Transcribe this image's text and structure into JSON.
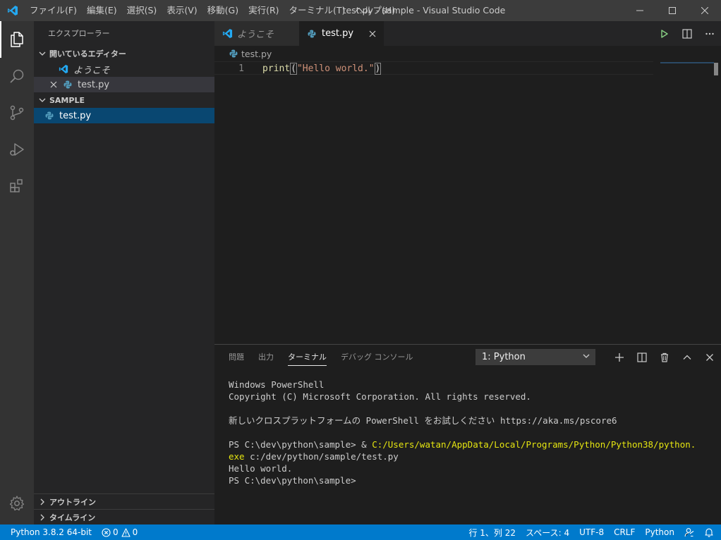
{
  "titlebar": {
    "menus": [
      "ファイル(F)",
      "編集(E)",
      "選択(S)",
      "表示(V)",
      "移動(G)",
      "実行(R)",
      "ターミナル(T)",
      "ヘルプ(H)"
    ],
    "title": "test.py - sample - Visual Studio Code"
  },
  "sidebar": {
    "title": "エクスプローラー",
    "open_editors": {
      "header": "開いているエディター",
      "items": [
        {
          "label": "ようこそ",
          "icon": "vscode-logo-icon"
        },
        {
          "label": "test.py",
          "icon": "python-icon"
        }
      ]
    },
    "folder": {
      "header": "SAMPLE",
      "items": [
        {
          "label": "test.py",
          "icon": "python-icon"
        }
      ]
    },
    "outline": "アウトライン",
    "timeline": "タイムライン"
  },
  "editor": {
    "tabs": [
      {
        "label": "ようこそ",
        "active": false
      },
      {
        "label": "test.py",
        "active": true
      }
    ],
    "breadcrumb": "test.py",
    "lines": [
      {
        "number": "1",
        "fn": "print",
        "open": "(",
        "str": "\"Hello world.\"",
        "close": ")"
      }
    ]
  },
  "panel": {
    "tabs": [
      "問題",
      "出力",
      "ターミナル",
      "デバッグ コンソール"
    ],
    "active_tab": "ターミナル",
    "terminal_select": "1: Python",
    "terminal": {
      "l1": "Windows PowerShell",
      "l2": "Copyright (C) Microsoft Corporation. All rights reserved.",
      "l3": "",
      "l4": "新しいクロスプラットフォームの PowerShell をお試しください https://aka.ms/pscore6",
      "l5": "",
      "l6_prompt": "PS C:\\dev\\python\\sample> & ",
      "l6_path": "C:/Users/watan/AppData/Local/Programs/Python/Python38/python.",
      "l7_path": "exe",
      "l7_rest": " c:/dev/python/sample/test.py",
      "l8": "Hello world.",
      "l9": "PS C:\\dev\\python\\sample>"
    }
  },
  "statusbar": {
    "interpreter": "Python 3.8.2 64-bit",
    "errors": "0",
    "warnings": "0",
    "position": "行 1、列 22",
    "spaces": "スペース: 4",
    "encoding": "UTF-8",
    "eol": "CRLF",
    "language": "Python"
  },
  "colors": {
    "accent": "#007acc",
    "activitybar": "#333333",
    "sidebar": "#252526",
    "editor": "#1e1e1e",
    "selection": "#094771"
  }
}
